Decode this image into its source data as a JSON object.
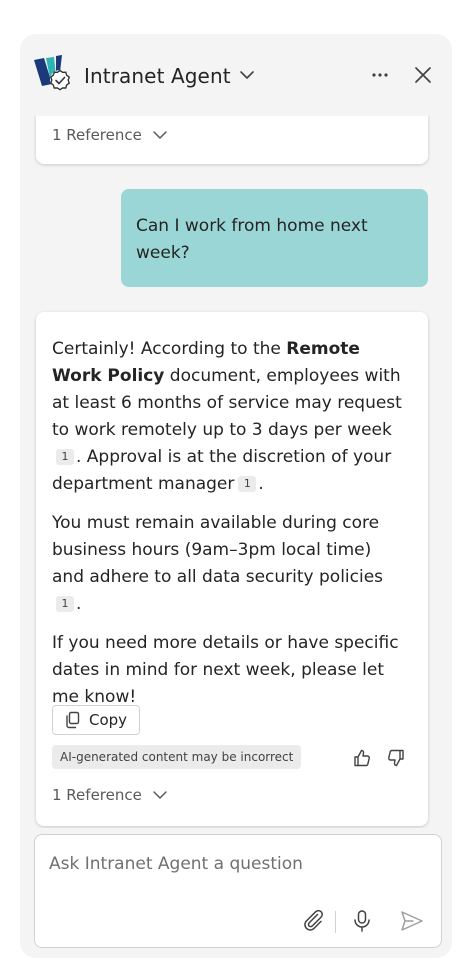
{
  "header": {
    "title": "Intranet Agent"
  },
  "previous_message": {
    "reference_label": "1 Reference"
  },
  "user_message": {
    "text": "Can I work from home next week?"
  },
  "bot_message": {
    "p1_intro": "Certainly! According to the ",
    "p1_policy": "Remote Work Policy",
    "p1_rest": " document, employees with at least 6 months of service may request to work remotely up to 3 days per week",
    "p1_cite1": "1",
    "p1_approval": ". Approval is at the discretion of your department manager",
    "p1_cite2": "1",
    "p1_end": ".",
    "p2_text": "You must remain available during core business hours (9am–3pm local time) and adhere to all data security policies",
    "p2_cite": "1",
    "p2_end": ".",
    "p3_text": "If you need more details or have specific dates in mind for next week, please let me know!",
    "copy_label": "Copy",
    "ai_disclaimer": "AI-generated content may be incorrect",
    "reference_label": "1 Reference"
  },
  "composer": {
    "placeholder": "Ask Intranet Agent a question"
  },
  "colors": {
    "user_bubble": "#9ad6d6",
    "panel_bg": "#f4f4f4",
    "logo_dark": "#1b3a7a",
    "logo_teal": "#2bb5b5"
  },
  "icons": [
    "agent-logo-icon",
    "chevron-down-icon",
    "more-icon",
    "close-icon",
    "copy-icon",
    "thumbs-up-icon",
    "thumbs-down-icon",
    "attach-icon",
    "microphone-icon",
    "send-icon"
  ]
}
